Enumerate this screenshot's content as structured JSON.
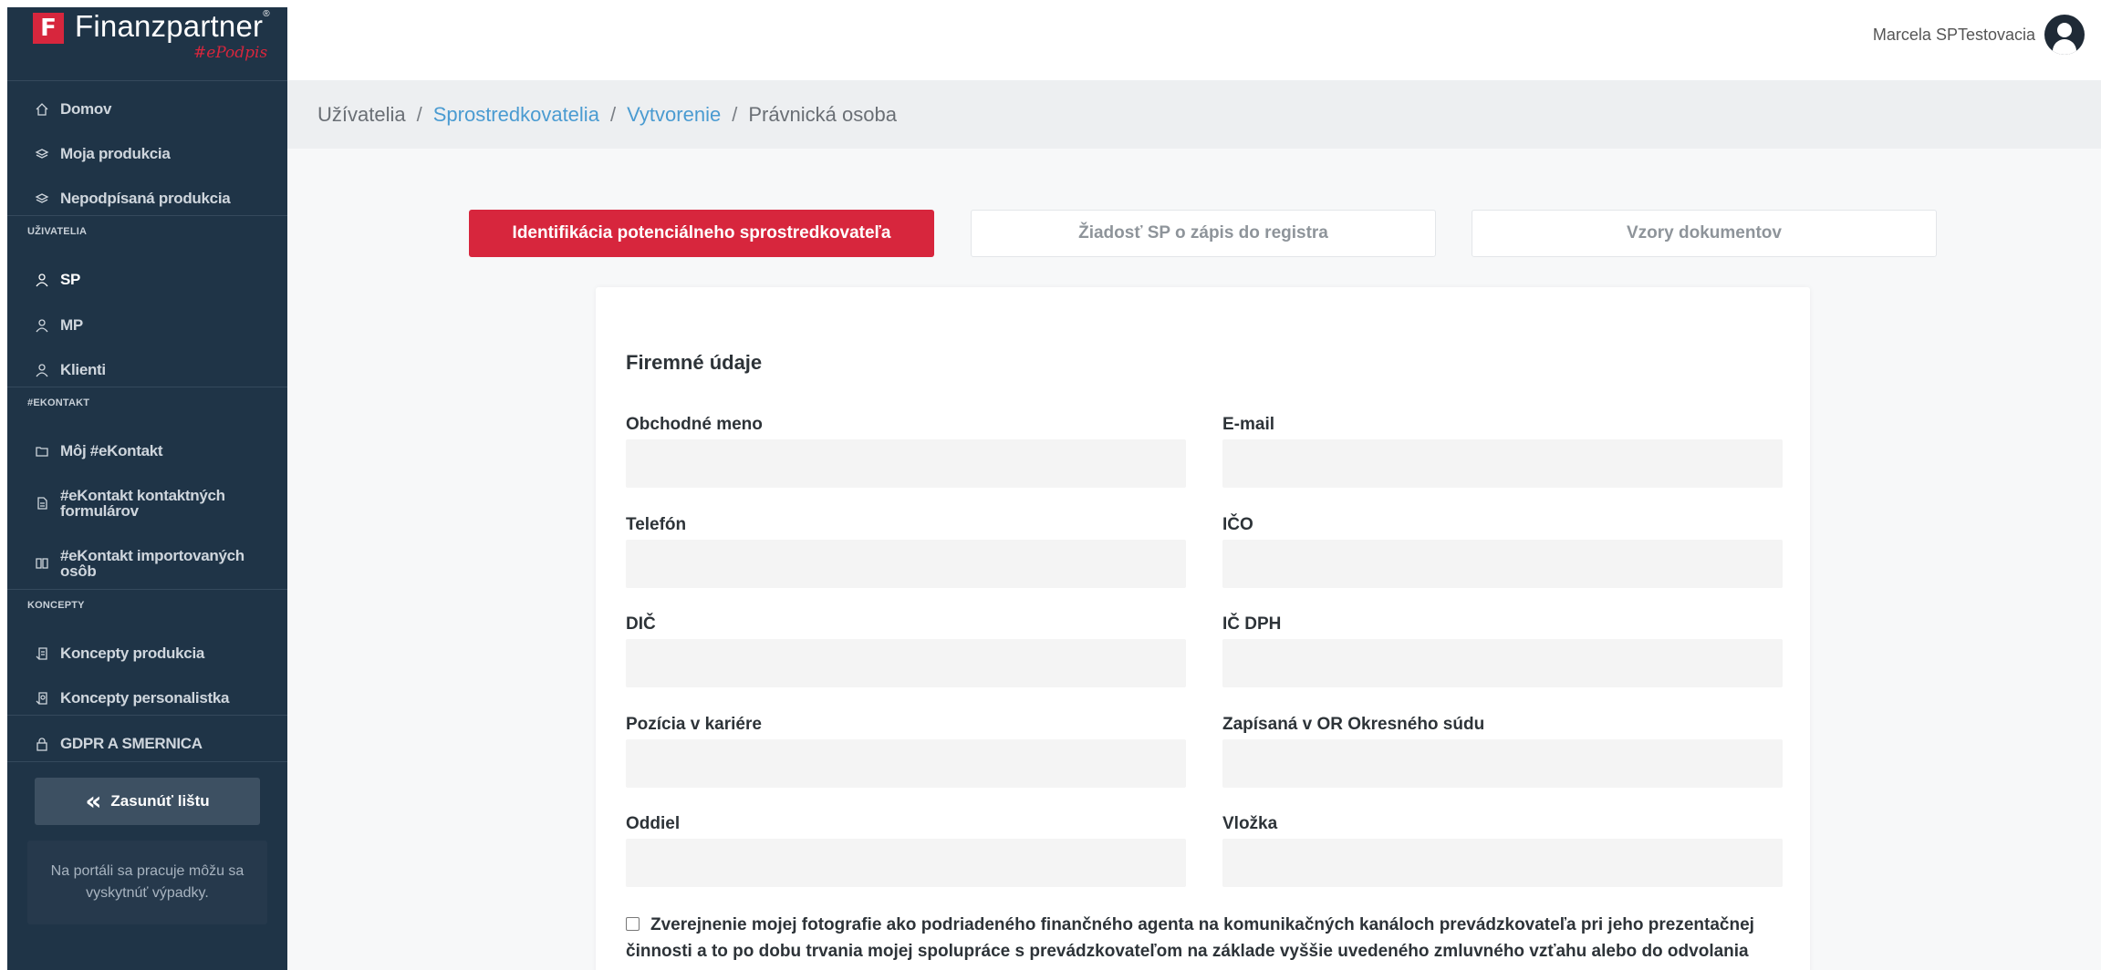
{
  "brand": {
    "badge": "F",
    "name": "Finanzpartner",
    "mark": "®",
    "sub": "#ePodpis"
  },
  "sidebar": {
    "items_top": [
      {
        "label": "Domov",
        "icon": "home-icon"
      },
      {
        "label": "Moja produkcia",
        "icon": "layers-icon"
      },
      {
        "label": "Nepodpísaná produkcia",
        "icon": "layers-icon"
      }
    ],
    "section_users": "UŽIVATELIA",
    "items_users": [
      {
        "label": "SP",
        "icon": "user-icon",
        "active": true
      },
      {
        "label": "MP",
        "icon": "user-icon"
      },
      {
        "label": "Klienti",
        "icon": "user-icon"
      }
    ],
    "section_ekontakt": "#EKONTAKT",
    "items_ekontakt": [
      {
        "label": "Môj #eKontakt",
        "icon": "folder-icon"
      },
      {
        "label_1": "#eKontakt kontaktných",
        "label_2": "formulárov",
        "icon": "document-icon"
      },
      {
        "label_1": "#eKontakt importovaných",
        "label_2": "osôb",
        "icon": "book-icon"
      }
    ],
    "section_koncepty": "KONCEPTY",
    "items_koncepty": [
      {
        "label": "Koncepty produkcia",
        "icon": "draft-icon"
      },
      {
        "label": "Koncepty personalistka",
        "icon": "draft-user-icon"
      }
    ],
    "gdpr": {
      "label": "GDPR A SMERNICA",
      "icon": "lock-icon"
    },
    "collapse_label": "Zasunúť lištu",
    "notice": "Na portáli sa pracuje môžu sa vyskytnúť výpadky."
  },
  "header": {
    "user_name": "Marcela SPTestovacia"
  },
  "breadcrumb": {
    "items": [
      "Užívatelia",
      "Sprostredkovatelia",
      "Vytvorenie",
      "Právnická osoba"
    ],
    "sep": "/"
  },
  "tabs": [
    {
      "label": "Identifikácia potenciálneho sprostredkovateľa",
      "active": true
    },
    {
      "label": "Žiadosť SP o zápis do registra",
      "active": false
    },
    {
      "label": "Vzory dokumentov",
      "active": false
    }
  ],
  "form": {
    "title": "Firemné údaje",
    "fields": [
      {
        "label": "Obchodné meno",
        "value": ""
      },
      {
        "label": "E-mail",
        "value": ""
      },
      {
        "label": "Telefón",
        "value": ""
      },
      {
        "label": "IČO",
        "value": ""
      },
      {
        "label": "DIČ",
        "value": ""
      },
      {
        "label": "IČ DPH",
        "value": ""
      },
      {
        "label": "Pozícia v kariére",
        "value": ""
      },
      {
        "label": "Zapísaná v OR Okresného súdu",
        "value": ""
      },
      {
        "label": "Oddiel",
        "value": ""
      },
      {
        "label": "Vložka",
        "value": ""
      }
    ],
    "consent_text": "Zverejnenie mojej fotografie ako podriadeného finančného agenta na komunikačných kanáloch prevádzkovateľa pri jeho prezentačnej činnosti a to po dobu trvania mojej spolupráce s prevádzkovateľom na základe vyššie uvedeného zmluvného vzťahu alebo do odvolania súhlasu."
  },
  "colors": {
    "sidebar_bg": "#1f3447",
    "accent": "#d7263d",
    "link": "#4a9bd1"
  }
}
